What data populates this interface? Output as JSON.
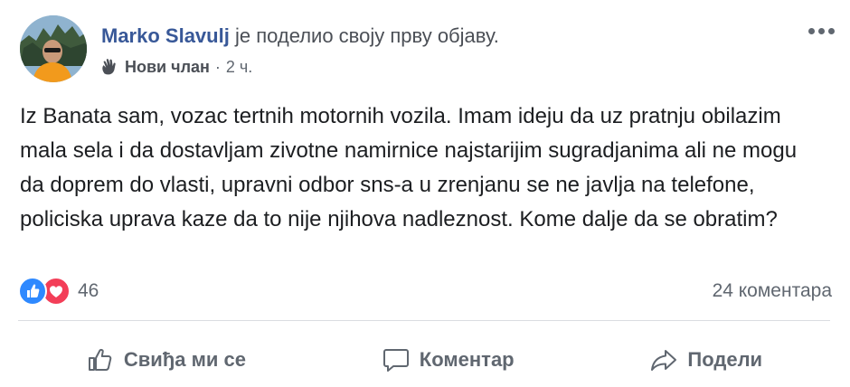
{
  "post": {
    "author": "Marko Slavulj",
    "action": "је поделио своју прву објаву.",
    "badge": "Нови члан",
    "separator": "·",
    "time": "2 ч.",
    "text": "Iz Banata sam, vozac tertnih motornih vozila. Imam ideju da uz pratnju obilazim mala sela i da dostavljam zivotne namirnice najstarijim sugradjanima ali ne mogu da doprem do vlasti, upravni odbor sns-a u zrenjanu se ne javlja na telefone, policiska uprava kaze da to nije njihova nadleznost. Kome dalje da se obratim?"
  },
  "reactions": {
    "count": "46",
    "types": [
      "like-icon",
      "love-icon"
    ],
    "like_color": "#2e89ff",
    "love_color": "#f33e58"
  },
  "comments": {
    "label": "24 коментара"
  },
  "actions": {
    "like_label": "Свиђа ми се",
    "comment_label": "Коментар",
    "share_label": "Подели"
  },
  "colors": {
    "author": "#385898",
    "secondary": "#606770",
    "text": "#1c1e21",
    "divider": "#dadde1"
  }
}
